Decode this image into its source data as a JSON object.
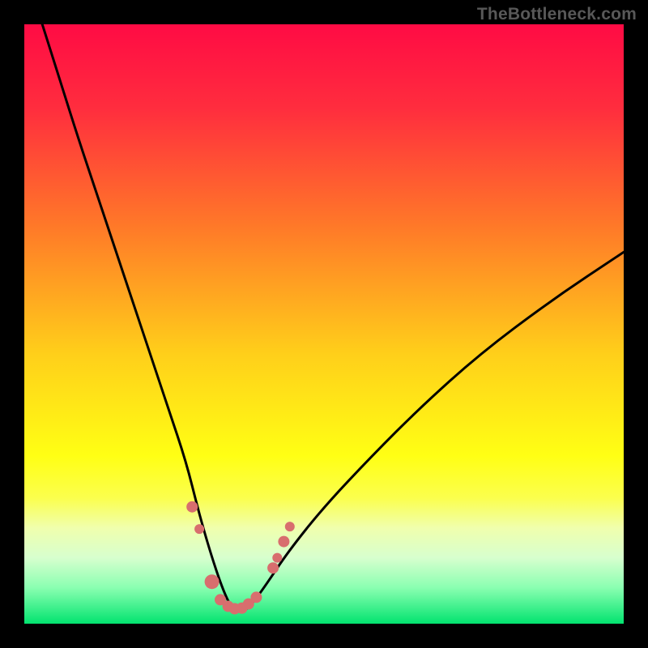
{
  "watermark": "TheBottleneck.com",
  "gradient": {
    "stops": [
      {
        "offset": "0%",
        "color": "#ff0b44"
      },
      {
        "offset": "14%",
        "color": "#ff2d3e"
      },
      {
        "offset": "34%",
        "color": "#ff7a28"
      },
      {
        "offset": "55%",
        "color": "#ffcf1a"
      },
      {
        "offset": "72%",
        "color": "#ffff14"
      },
      {
        "offset": "79%",
        "color": "#fbff4d"
      },
      {
        "offset": "84%",
        "color": "#f0ffad"
      },
      {
        "offset": "89%",
        "color": "#d7ffce"
      },
      {
        "offset": "94%",
        "color": "#8affb1"
      },
      {
        "offset": "100%",
        "color": "#02e36f"
      }
    ]
  },
  "chart_data": {
    "type": "line",
    "title": "",
    "xlabel": "",
    "ylabel": "",
    "xlim": [
      0,
      100
    ],
    "ylim": [
      0,
      100
    ],
    "x_optimum": 35,
    "series": [
      {
        "name": "bottleneck-curve",
        "x": [
          3,
          6,
          9,
          12,
          15,
          18,
          21,
          24,
          27,
          29,
          31,
          33,
          34.5,
          36,
          37.5,
          40,
          44,
          50,
          58,
          66,
          76,
          88,
          100
        ],
        "y": [
          100,
          90.5,
          81,
          72,
          63,
          54,
          45,
          36,
          27,
          19,
          12,
          6,
          2.7,
          1.8,
          2.7,
          6,
          12,
          19.5,
          28,
          36,
          45,
          54,
          62
        ]
      }
    ],
    "markers": {
      "name": "highlight-dots",
      "color": "#d86e6e",
      "points": [
        {
          "x": 28.0,
          "y": 19.5,
          "r": 7
        },
        {
          "x": 29.2,
          "y": 15.8,
          "r": 6
        },
        {
          "x": 31.3,
          "y": 7.0,
          "r": 9
        },
        {
          "x": 32.7,
          "y": 4.0,
          "r": 7
        },
        {
          "x": 34.0,
          "y": 2.9,
          "r": 7
        },
        {
          "x": 35.1,
          "y": 2.5,
          "r": 7
        },
        {
          "x": 36.3,
          "y": 2.6,
          "r": 7
        },
        {
          "x": 37.4,
          "y": 3.3,
          "r": 7
        },
        {
          "x": 38.7,
          "y": 4.4,
          "r": 7
        },
        {
          "x": 41.5,
          "y": 9.3,
          "r": 7
        },
        {
          "x": 42.2,
          "y": 11.0,
          "r": 6
        },
        {
          "x": 43.3,
          "y": 13.7,
          "r": 7
        },
        {
          "x": 44.3,
          "y": 16.2,
          "r": 6
        }
      ]
    }
  }
}
